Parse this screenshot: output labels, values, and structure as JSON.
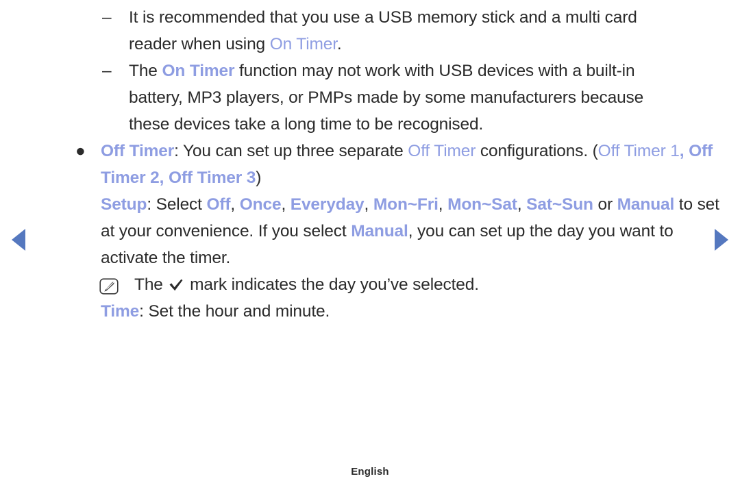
{
  "nav": {
    "prev_label": "previous-page",
    "next_label": "next-page",
    "arrow_color": "#5578bf"
  },
  "theme": {
    "text_color": "#2b2b2b",
    "highlight_color": "#8e9de2",
    "background": "#ffffff"
  },
  "body": {
    "dash_marker": "–",
    "bullet_marker": "●",
    "items": [
      {
        "type": "dash",
        "parts": [
          {
            "text": "It is recommended that you use a USB memory stick and a multi card reader when using ",
            "style": "plain"
          },
          {
            "text": "On Timer",
            "style": "blue-plain"
          },
          {
            "text": ".",
            "style": "plain"
          }
        ]
      },
      {
        "type": "dash",
        "parts": [
          {
            "text": "The ",
            "style": "plain"
          },
          {
            "text": "On Timer",
            "style": "blue"
          },
          {
            "text": " function may not work with USB devices with a built-in battery, MP3 players, or PMPs made by some manufacturers because these devices take a long time to be recognised.",
            "style": "plain"
          }
        ]
      },
      {
        "type": "bullet",
        "parts": [
          {
            "text": "Off Timer",
            "style": "blue"
          },
          {
            "text": ": You can set up three separate ",
            "style": "plain"
          },
          {
            "text": "Off Timer",
            "style": "blue-plain"
          },
          {
            "text": " configurations. (",
            "style": "plain"
          },
          {
            "text": "Off Timer 1",
            "style": "blue-plain"
          },
          {
            "text": ", ",
            "style": "blue"
          },
          {
            "text": "Off Timer 2",
            "style": "blue"
          },
          {
            "text": ", ",
            "style": "blue"
          },
          {
            "text": "Off Timer 3",
            "style": "blue"
          },
          {
            "text": ")",
            "style": "plain"
          }
        ]
      },
      {
        "type": "plain",
        "parts": [
          {
            "text": "Setup",
            "style": "blue"
          },
          {
            "text": ": Select ",
            "style": "plain"
          },
          {
            "text": "Off",
            "style": "blue"
          },
          {
            "text": ", ",
            "style": "plain"
          },
          {
            "text": "Once",
            "style": "blue"
          },
          {
            "text": ", ",
            "style": "plain"
          },
          {
            "text": "Everyday",
            "style": "blue"
          },
          {
            "text": ", ",
            "style": "plain"
          },
          {
            "text": "Mon~Fri",
            "style": "blue"
          },
          {
            "text": ", ",
            "style": "plain"
          },
          {
            "text": "Mon~Sat",
            "style": "blue"
          },
          {
            "text": ", ",
            "style": "plain"
          },
          {
            "text": "Sat~Sun",
            "style": "blue"
          },
          {
            "text": " or ",
            "style": "plain"
          },
          {
            "text": "Manual",
            "style": "blue"
          },
          {
            "text": " to set at your convenience. If you select ",
            "style": "plain"
          },
          {
            "text": "Manual",
            "style": "blue"
          },
          {
            "text": ", you can set up the day you want to activate the timer.",
            "style": "plain"
          }
        ]
      },
      {
        "type": "note",
        "icon": "note-pencil-icon",
        "parts": [
          {
            "text": "The ",
            "style": "plain"
          },
          {
            "text": "",
            "style": "checkmark"
          },
          {
            "text": " mark indicates the day you’ve selected.",
            "style": "plain"
          }
        ]
      },
      {
        "type": "plain",
        "parts": [
          {
            "text": "Time",
            "style": "blue"
          },
          {
            "text": ": Set the hour and minute.",
            "style": "plain"
          }
        ]
      }
    ]
  },
  "footer": {
    "language": "English"
  }
}
